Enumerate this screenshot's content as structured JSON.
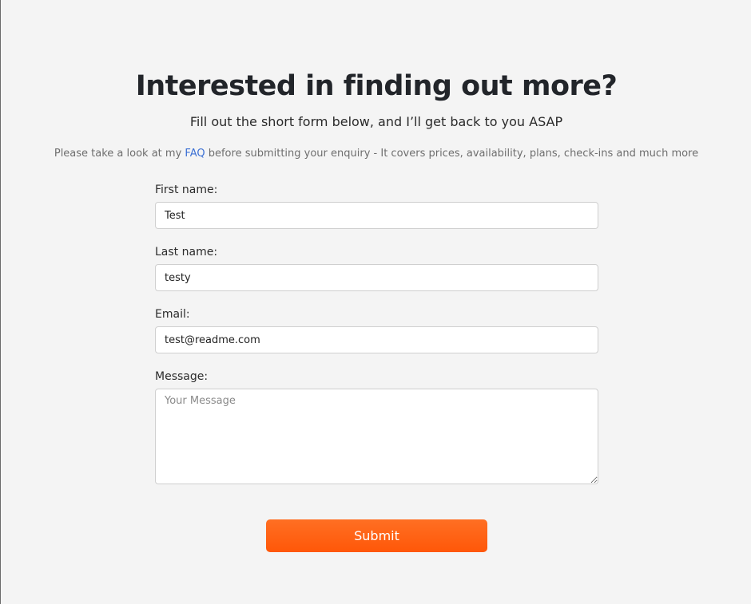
{
  "header": {
    "title": "Interested in finding out more?",
    "subtitle": "Fill out the short form below, and I’ll get back to you ASAP",
    "notice_before": "Please take a look at my ",
    "notice_link": "FAQ",
    "notice_after": " before submitting your enquiry - It covers prices, availability, plans, check-ins and much more"
  },
  "form": {
    "first_name": {
      "label": "First name:",
      "value": "Test"
    },
    "last_name": {
      "label": "Last name:",
      "value": "testy"
    },
    "email": {
      "label": "Email:",
      "value": "test@readme.com"
    },
    "message": {
      "label": "Message:",
      "placeholder": "Your Message",
      "value": ""
    },
    "submit_label": "Submit"
  },
  "colors": {
    "background": "#f4f4f4",
    "accent": "#ff6116",
    "link": "#3b6fd4"
  }
}
